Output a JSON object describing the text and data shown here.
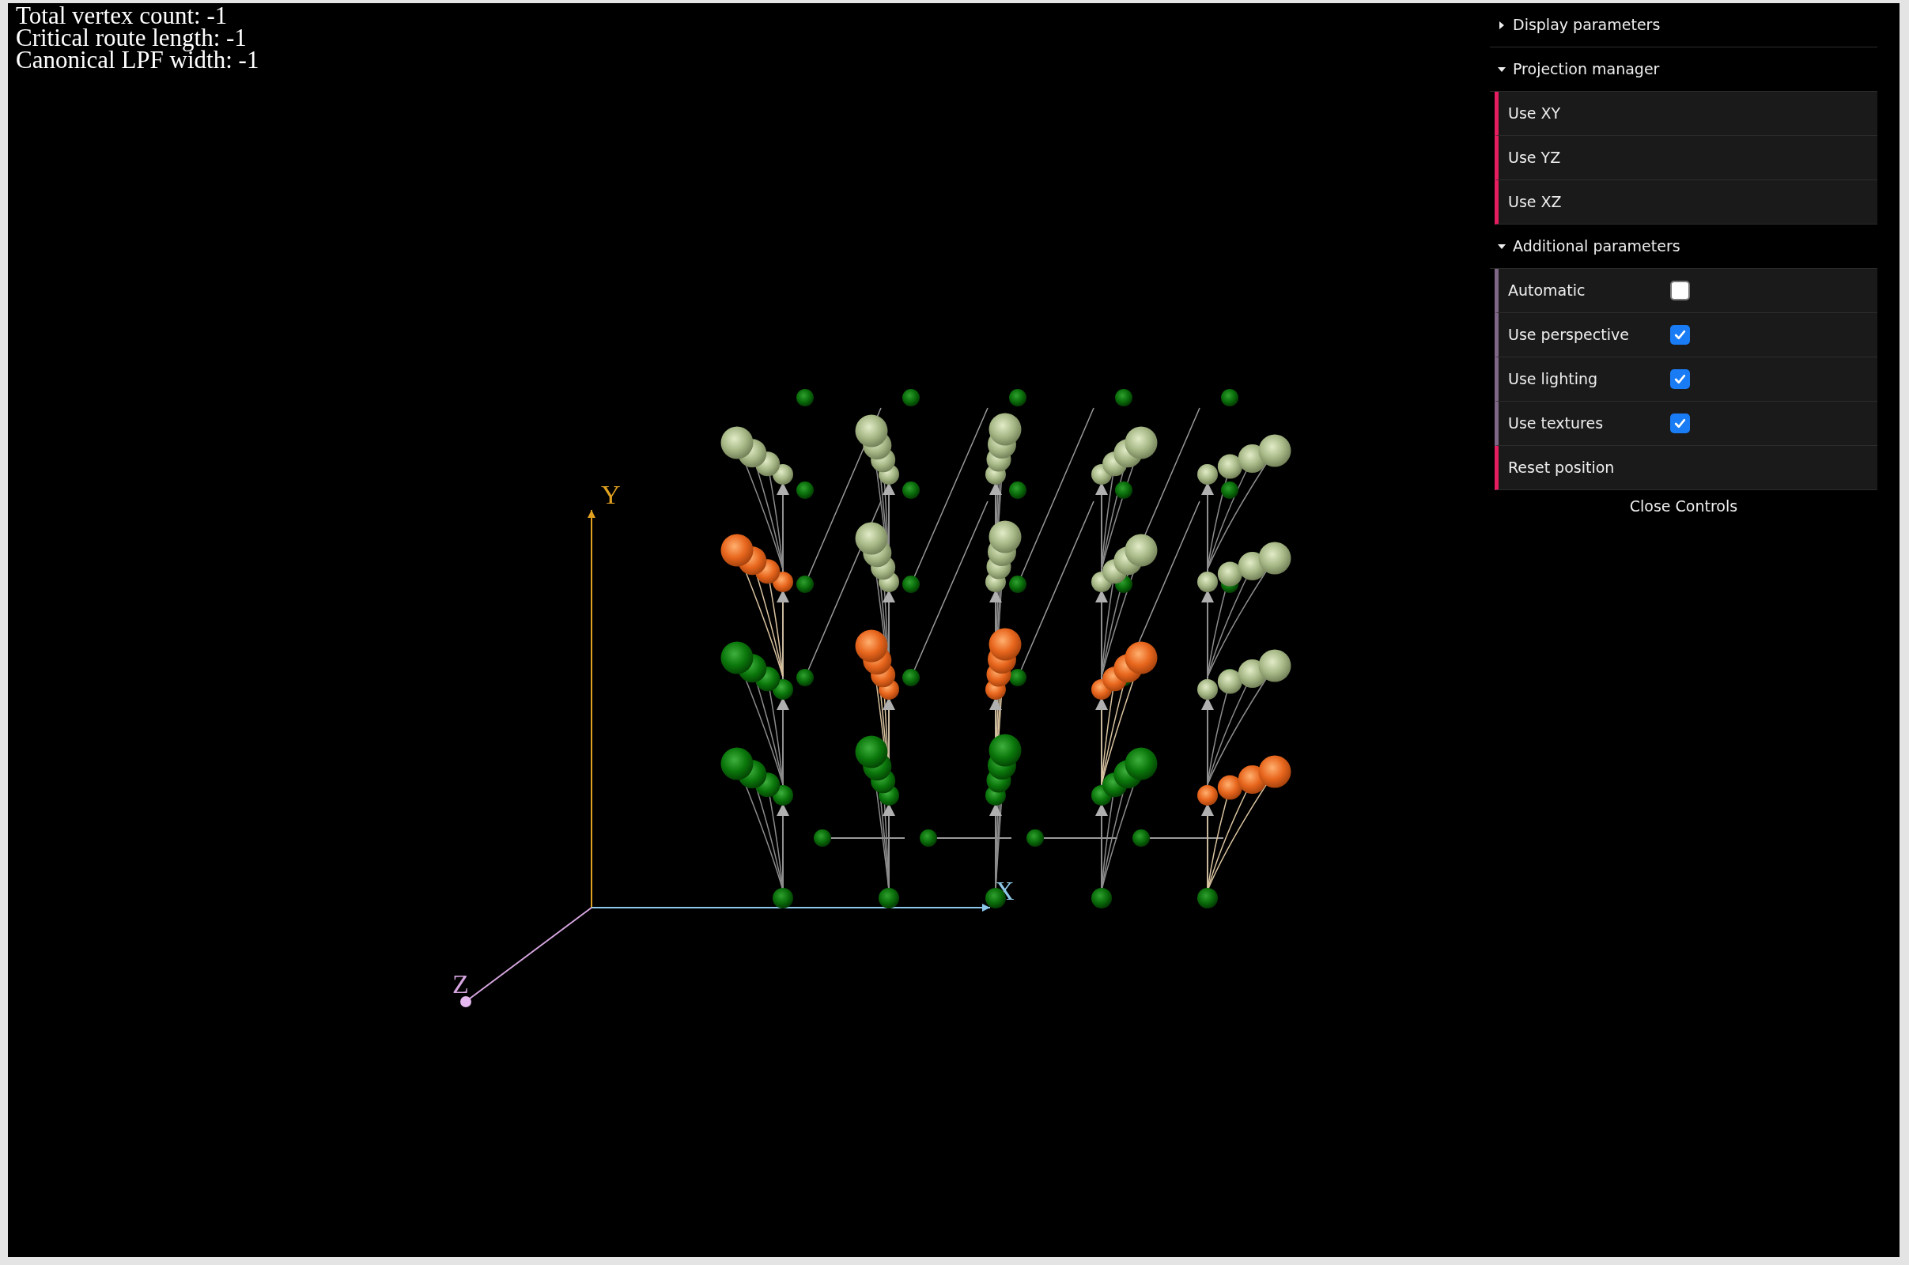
{
  "stats": [
    "Total vertex count: -1",
    "Critical route length: -1",
    "Canonical LPF width: -1"
  ],
  "axis_labels": {
    "x": "X",
    "y": "Y",
    "z": "Z"
  },
  "controls": {
    "folders": [
      {
        "title": "Display parameters",
        "expanded": false
      },
      {
        "title": "Projection manager",
        "expanded": true,
        "items": [
          {
            "kind": "button",
            "label": "Use XY"
          },
          {
            "kind": "button",
            "label": "Use YZ"
          },
          {
            "kind": "button",
            "label": "Use XZ"
          }
        ]
      },
      {
        "title": "Additional parameters",
        "expanded": true,
        "items": [
          {
            "kind": "checkbox",
            "label": "Automatic",
            "checked": false
          },
          {
            "kind": "checkbox",
            "label": "Use perspective",
            "checked": true
          },
          {
            "kind": "checkbox",
            "label": "Use lighting",
            "checked": true
          },
          {
            "kind": "checkbox",
            "label": "Use textures",
            "checked": true
          },
          {
            "kind": "button",
            "label": "Reset position"
          }
        ]
      }
    ],
    "close_label": "Close Controls"
  }
}
